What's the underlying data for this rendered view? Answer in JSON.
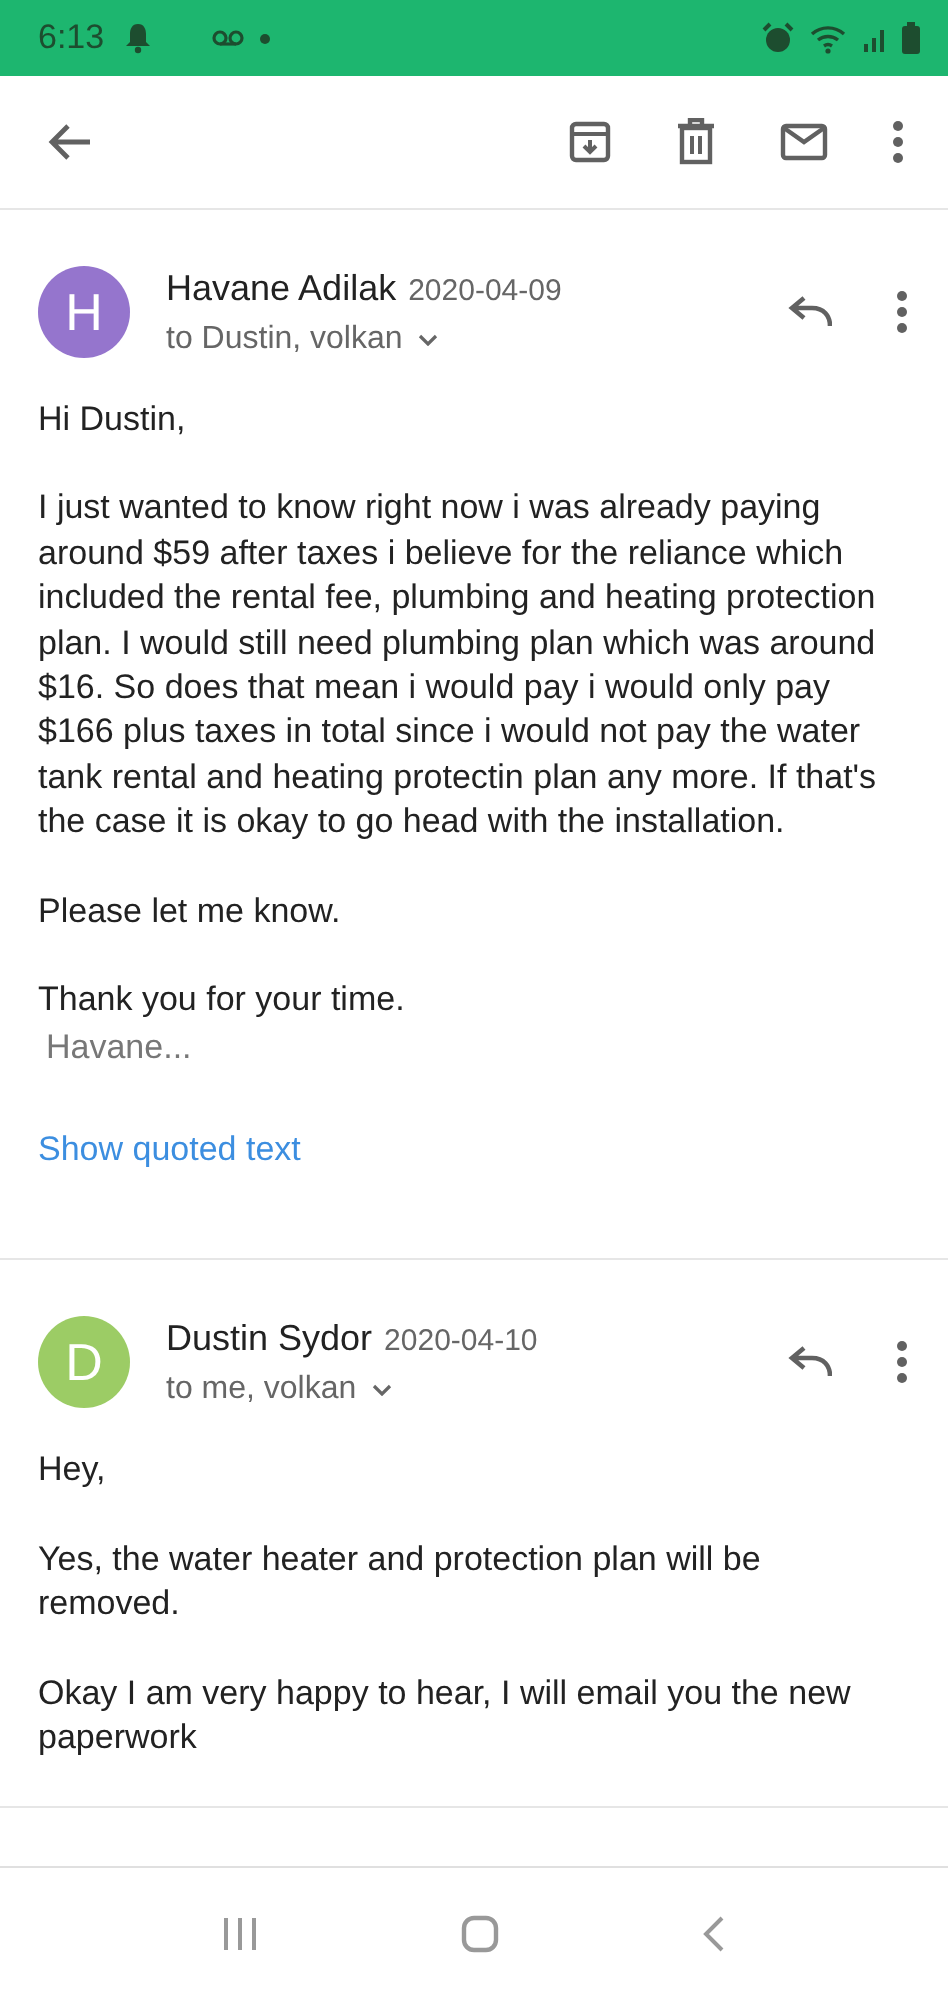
{
  "status_bar": {
    "time": "6:13"
  },
  "messages": [
    {
      "avatar": "H",
      "color": "#9575cd",
      "sender": "Havane Adilak",
      "date": "2020-04-09",
      "recipients": "to Dustin, volkan",
      "paragraphs": [
        "Hi Dustin,",
        "I just wanted to know right now i was already paying around $59 after taxes i believe for the reliance which included the rental fee, plumbing and heating protection plan. I would still need plumbing plan which was around $16. So does that mean i would pay i would only pay $166 plus taxes in total since i would not pay the water tank rental and heating protectin plan any more. If that's the case it is okay to go head with the installation.",
        "Please let me know.",
        "Thank you for your time."
      ],
      "signature": "Havane...",
      "quoted_link": "Show quoted text"
    },
    {
      "avatar": "D",
      "color": "#9ccc65",
      "sender": "Dustin Sydor",
      "date": "2020-04-10",
      "recipients": "to me, volkan",
      "paragraphs": [
        "Hey,",
        "Yes, the water heater and protection plan will be removed.",
        "Okay I am very happy to hear, I will email you the new paperwork"
      ]
    }
  ]
}
